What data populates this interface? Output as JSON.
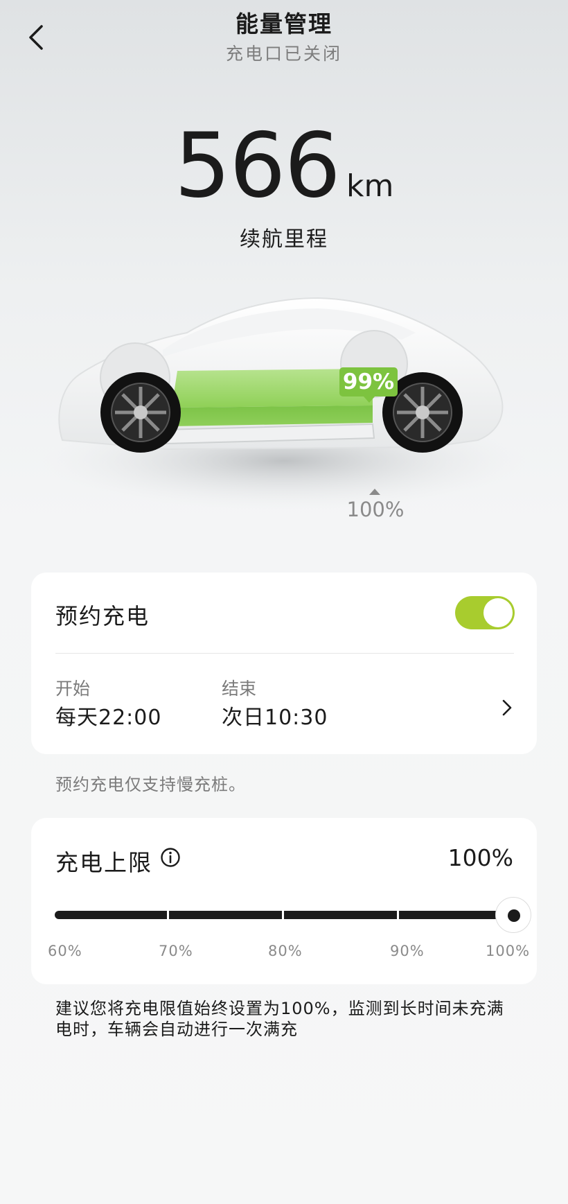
{
  "header": {
    "title": "能量管理",
    "subtitle": "充电口已关闭"
  },
  "range": {
    "value": "566",
    "unit": "km",
    "label": "续航里程"
  },
  "battery": {
    "soc_label": "99%",
    "soc_level": 0.99,
    "limit_label": "100%",
    "fill_color": "#7dc33f"
  },
  "schedule": {
    "title": "预约充电",
    "enabled": true,
    "start_label": "开始",
    "start_value": "每天22:00",
    "end_label": "结束",
    "end_value": "次日10:30",
    "note": "预约充电仅支持慢充桩。",
    "toggle_color": "#a8cc2e"
  },
  "charge_limit": {
    "title": "充电上限",
    "value": "100%",
    "level": 1.0,
    "ticks": [
      "60%",
      "70%",
      "80%",
      "90%",
      "100%"
    ]
  },
  "advice": "建议您将充电限值始终设置为100%，监测到长时间未充满电时，车辆会自动进行一次满充",
  "icons": {
    "back": "chevron-left-icon",
    "info": "info-icon",
    "chevron": "chevron-right-icon"
  }
}
